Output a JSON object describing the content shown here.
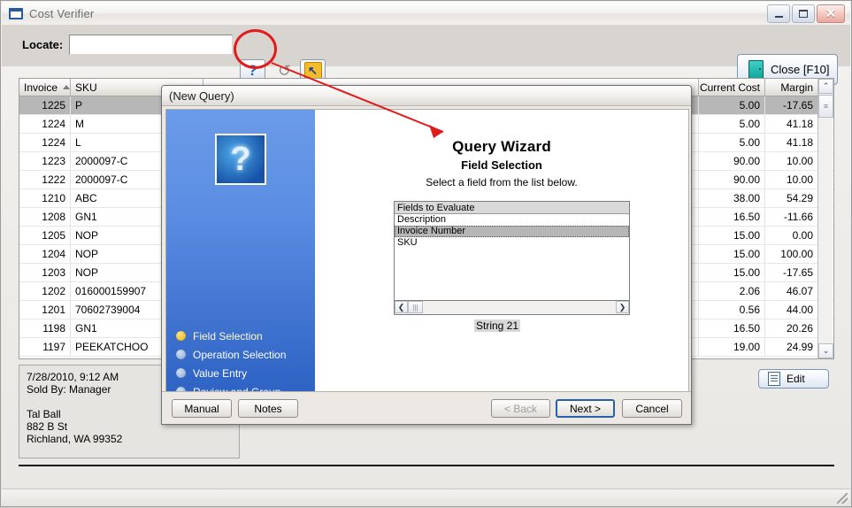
{
  "window": {
    "title": "Cost Verifier",
    "icon": "window-icon",
    "minimize": "_",
    "maximize": "□",
    "close": "✕"
  },
  "toolbar": {
    "locate_label": "Locate:",
    "locate_value": "",
    "locate_placeholder": "",
    "help_button_glyph": "?",
    "refresh_button_glyph": "↺",
    "jump_button_glyph": "↖",
    "close_button_label": "Close [F10]"
  },
  "grid": {
    "columns": [
      "Invoice",
      "SKU",
      "",
      "Current Cost",
      "Margin"
    ],
    "sort_column": "Invoice",
    "sort_direction": "ascending",
    "rows": [
      {
        "invoice": "1225",
        "sku": "P",
        "cost": "5.00",
        "margin": "-17.65",
        "selected": true
      },
      {
        "invoice": "1224",
        "sku": "M",
        "cost": "5.00",
        "margin": "41.18",
        "selected": false
      },
      {
        "invoice": "1224",
        "sku": "L",
        "cost": "5.00",
        "margin": "41.18",
        "selected": false
      },
      {
        "invoice": "1223",
        "sku": "2000097-C",
        "cost": "90.00",
        "margin": "10.00",
        "selected": false
      },
      {
        "invoice": "1222",
        "sku": "2000097-C",
        "cost": "90.00",
        "margin": "10.00",
        "selected": false
      },
      {
        "invoice": "1210",
        "sku": "ABC",
        "cost": "38.00",
        "margin": "54.29",
        "selected": false
      },
      {
        "invoice": "1208",
        "sku": "GN1",
        "cost": "16.50",
        "margin": "-11.66",
        "selected": false
      },
      {
        "invoice": "1205",
        "sku": "NOP",
        "cost": "15.00",
        "margin": "0.00",
        "selected": false
      },
      {
        "invoice": "1204",
        "sku": "NOP",
        "cost": "15.00",
        "margin": "100.00",
        "selected": false
      },
      {
        "invoice": "1203",
        "sku": "NOP",
        "cost": "15.00",
        "margin": "-17.65",
        "selected": false
      },
      {
        "invoice": "1202",
        "sku": "016000159907",
        "cost": "2.06",
        "margin": "46.07",
        "selected": false
      },
      {
        "invoice": "1201",
        "sku": "70602739004",
        "cost": "0.56",
        "margin": "44.00",
        "selected": false
      },
      {
        "invoice": "1198",
        "sku": "GN1",
        "cost": "16.50",
        "margin": "20.26",
        "selected": false
      },
      {
        "invoice": "1197",
        "sku": "PEEKATCHOO",
        "cost": "19.00",
        "margin": "24.99",
        "selected": false
      }
    ],
    "scroll_up": "⌃",
    "scroll_down": "⌄"
  },
  "info_panel": {
    "line1": "7/28/2010,  9:12 AM",
    "line2": "Sold By: Manager",
    "line3": "",
    "line4": "Tal Ball",
    "line5": "882 B St",
    "line6": "Richland, WA   99352"
  },
  "edit_button": {
    "label": "Edit"
  },
  "wizard": {
    "title": "(New Query)",
    "sidebar_icon": "?",
    "heading": "Query Wizard",
    "subheading": "Field Selection",
    "instruction": "Select a field from the list below.",
    "steps": [
      {
        "label": "Field Selection",
        "active": true
      },
      {
        "label": "Operation Selection",
        "active": false
      },
      {
        "label": "Value Entry",
        "active": false
      },
      {
        "label": "Review and Group",
        "active": false
      }
    ],
    "list_header": "Fields to Evaluate",
    "list_items": [
      {
        "label": "Description",
        "selected": false
      },
      {
        "label": "Invoice Number",
        "selected": true
      },
      {
        "label": "SKU",
        "selected": false
      }
    ],
    "scroll_left": "❮",
    "scroll_right": "❯",
    "status_text": "String 21",
    "buttons": {
      "manual": "Manual",
      "manual_accel": "M",
      "notes": "Notes",
      "notes_accel": "N",
      "back": "< Back",
      "back_accel": "B",
      "next": "Next >",
      "next_accel": "N",
      "cancel": "Cancel"
    }
  },
  "annotation": {
    "highlight_color": "#e01b1b",
    "arrow_color": "#e01b1b",
    "target": "help-button"
  }
}
